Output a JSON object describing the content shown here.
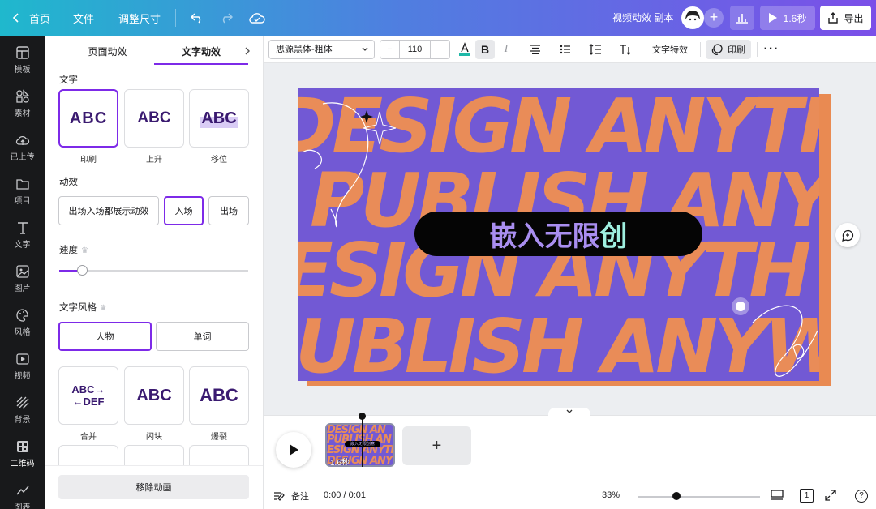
{
  "topbar": {
    "home": "首页",
    "file": "文件",
    "resize": "调整尺寸",
    "title": "视频动效 副本",
    "play_duration": "1.6秒",
    "export": "导出"
  },
  "rail": [
    {
      "label": "模板",
      "icon": "template-icon"
    },
    {
      "label": "素材",
      "icon": "elements-icon"
    },
    {
      "label": "已上传",
      "icon": "upload-icon"
    },
    {
      "label": "项目",
      "icon": "folder-icon"
    },
    {
      "label": "文字",
      "icon": "text-icon"
    },
    {
      "label": "图片",
      "icon": "photo-icon"
    },
    {
      "label": "风格",
      "icon": "palette-icon"
    },
    {
      "label": "视频",
      "icon": "video-icon"
    },
    {
      "label": "背景",
      "icon": "background-icon"
    },
    {
      "label": "二维码",
      "icon": "qrcode-icon"
    },
    {
      "label": "图表",
      "icon": "chart-icon"
    }
  ],
  "panel": {
    "tabs": [
      "页面动效",
      "文字动效"
    ],
    "text_section": "文字",
    "text_anims": [
      {
        "preview": "ABC",
        "label": "印刷"
      },
      {
        "preview": "ABC",
        "label": "上升"
      },
      {
        "preview": "ABC",
        "label": "移位"
      }
    ],
    "effect_section": "动效",
    "effect_options": [
      "出场入场都展示动效",
      "入场",
      "出场"
    ],
    "speed_section": "速度",
    "speed_value": 0.12,
    "style_section": "文字风格",
    "style_options": [
      "人物",
      "单词"
    ],
    "style_anims": [
      {
        "label": "合并"
      },
      {
        "preview": "ABC",
        "label": "闪块"
      },
      {
        "preview": "ABC",
        "label": "爆裂"
      }
    ],
    "merge_line1": "ABC→",
    "merge_line2": "←DEF",
    "remove_button": "移除动画"
  },
  "toolbar": {
    "font": "思源黑体-粗体",
    "minus": "−",
    "font_size": "110",
    "plus": "+",
    "text_effects": "文字特效",
    "print": "印刷"
  },
  "canvas": {
    "rows": [
      "DESIGN ANYTH",
      "PUBLISH ANYW",
      "ESIGN ANYTH",
      "UBLISH ANYW"
    ],
    "headline_main": "嵌入无限",
    "headline_tail": "创"
  },
  "timeline": {
    "thumb_rows": [
      "DESIGN AN",
      "PUBLISH AN",
      "ESIGN ANYTI",
      "DESIGN ANY"
    ],
    "thumb_pill": "嵌入无限创意",
    "thumb_duration": "1.6秒",
    "add": "+",
    "notes": "备注",
    "time": "0:00 / 0:01",
    "zoom": "33%",
    "page_count": "1",
    "help": "?",
    "zoom_value": 0.33
  },
  "colors": {
    "accent": "#7d2ae8",
    "canvas_bg": "#7259d4",
    "canvas_text": "#e98c58"
  }
}
